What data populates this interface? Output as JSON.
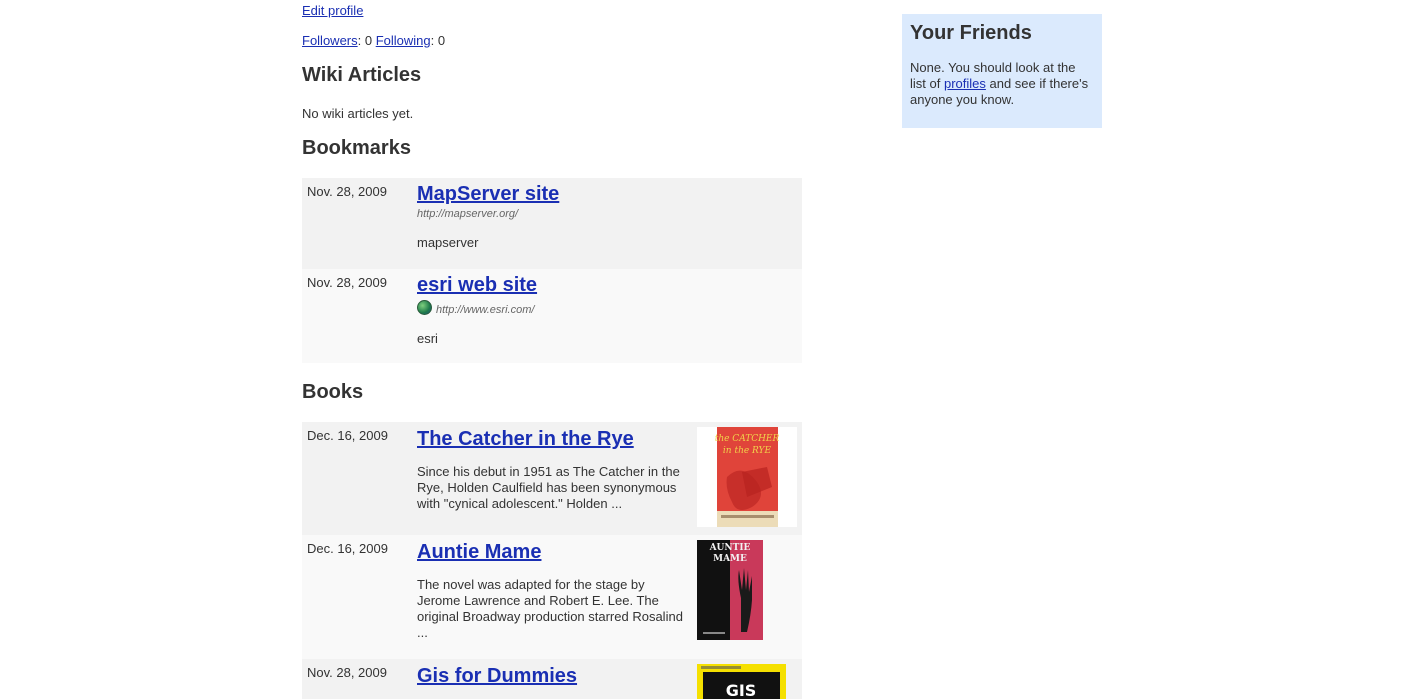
{
  "profile": {
    "edit_profile": "Edit profile",
    "followers_label": "Followers",
    "followers_count": ": 0 ",
    "following_label": "Following",
    "following_count": ": 0"
  },
  "wiki": {
    "heading": "Wiki Articles",
    "empty_text": "No wiki articles yet."
  },
  "bookmarks": {
    "heading": "Bookmarks",
    "items": [
      {
        "date": "Nov. 28, 2009",
        "title": "MapServer site",
        "url": "http://mapserver.org/",
        "desc": "mapserver"
      },
      {
        "date": "Nov. 28, 2009",
        "title": "esri web site",
        "url": "http://www.esri.com/",
        "desc": "esri",
        "favicon": "globe-icon"
      }
    ]
  },
  "books": {
    "heading": "Books",
    "items": [
      {
        "date": "Dec. 16, 2009",
        "title": "The Catcher in the Rye",
        "desc": "Since his debut in 1951 as The Catcher in the Rye, Holden Caulfield has been synonymous with \"cynical adolescent.\" Holden ...",
        "cover_color": "#e0443a"
      },
      {
        "date": "Dec. 16, 2009",
        "title": "Auntie Mame",
        "desc": "The novel was adapted for the stage by Jerome Lawrence and Robert E. Lee. The original Broadway production starred Rosalind ...",
        "cover_color": "#c9395a"
      },
      {
        "date": "Nov. 28, 2009",
        "title": "Gis for Dummies",
        "desc": "",
        "cover_color": "#f5e000"
      }
    ]
  },
  "friends": {
    "heading": "Your Friends",
    "text_before": "None. You should look at the list of ",
    "link": "profiles",
    "text_after": " and see if there's anyone you know."
  },
  "colors": {
    "link": "#1a2fb3",
    "friends_bg": "#dbeafd",
    "row_odd": "#f2f2f2",
    "row_even": "#f9f9f9"
  }
}
